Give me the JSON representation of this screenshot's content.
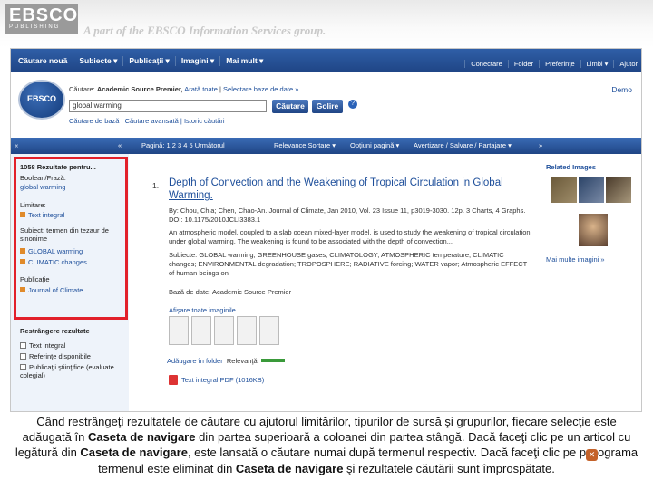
{
  "header": {
    "logo": "EBSCO",
    "logo_sub": "PUBLISHING",
    "tagline": "A part of the EBSCO Information Services group."
  },
  "topnav": {
    "left": [
      "Căutare nouă",
      "Subiecte ▾",
      "Publicaţii ▾",
      "Imagini ▾",
      "Mai mult ▾"
    ],
    "right": [
      "Conectare",
      "Folder",
      "Preferinţe",
      "Limbi ▾",
      "Ajutor"
    ]
  },
  "search": {
    "db_label": "Căutare:",
    "db_name": "Academic Source Premier,",
    "db_show": "Arată toate",
    "db_choose": "Selectare baze de date »",
    "demo": "Demo",
    "query": "global warming",
    "search_button": "Căutare",
    "clear_button": "Golire",
    "links": [
      "Căutare de bază",
      "Căutare avansată",
      "Istoric căutări"
    ]
  },
  "results_bar": {
    "pages": "Pagină: 1 2 3 4 5 Următorul",
    "relevance": "Relevance Sortare ▾",
    "options": "Opţiuni pagină ▾",
    "alert": "Avertizare / Salvare / Partajare ▾"
  },
  "left": {
    "results_count": "1058 Rezultate pentru...",
    "boolean_label": "Boolean/Frază:",
    "boolean_value": "global warming",
    "limit_head": "Limitare:",
    "limit_item": "Text integral",
    "subject_head": "Subiect: termen din tezaur de sinonime",
    "subject_items": [
      "GLOBAL warming",
      "CLIMATIC changes"
    ],
    "pub_head": "Publicaţie",
    "pub_item": "Journal of Climate",
    "refine_head": "Restrângere rezultate",
    "refine_items": [
      "Text integral",
      "Referinţe disponibile",
      "Publicaţii ştiinţifice (evaluate colegial)"
    ]
  },
  "result": {
    "num": "1.",
    "title": "Depth of Convection and the Weakening of Tropical Circulation in Global Warming.",
    "lines": [
      "By: Chou, Chia; Chen, Chao-An. Journal of Climate, Jan 2010, Vol. 23 Issue 11, p3019-3030. 12p. 3 Charts, 4 Graphs. DOI: 10.1175/2010JCLI3383.1",
      "An atmospheric model, coupled to a slab ocean mixed-layer model, is used to study the weakening of tropical circulation under global warming. The weakening is found to be associated with the depth of convection...",
      "Subiecte: GLOBAL warming; GREENHOUSE gases; CLIMATOLOGY; ATMOSPHERIC temperature; CLIMATIC changes; ENVIRONMENTAL degradation; TROPOSPHERE; RADIATIVE forcing; WATER vapor; Atmospheric EFFECT of human beings on",
      "Bază de date: Academic Source Premier"
    ],
    "thumbs_label": "Afişare toate imaginile",
    "add_folder": "Adăugare în folder",
    "relevancy": "Relevanţă:",
    "pdf": "Text integral PDF (1016KB)"
  },
  "right": {
    "related": "Related Images",
    "more": "Mai multe imagini »"
  },
  "caption": {
    "p1": "Când restrângeţi rezultatele de căutare cu ajutorul limitărilor, tipurilor de sursă şi grupurilor, fiecare selecţie este adăugată în ",
    "b1": "Caseta de navigare",
    "p2": " din partea superioară a coloanei din partea stângă. Dacă faceţi clic pe un articol cu legătură din ",
    "b2": "Caseta de navigare",
    "p3": ", este lansată o căutare numai după termenul respectiv. Dacă faceţi clic pe p",
    "p4": "ograma    termenul este eliminat din ",
    "b3": "Caseta de navigare",
    "p5": " şi rezultatele căutării sunt împrospătate."
  },
  "colors": {
    "nav": "#1f4585",
    "highlight": "#e2202a",
    "link": "#1d4e9a"
  }
}
